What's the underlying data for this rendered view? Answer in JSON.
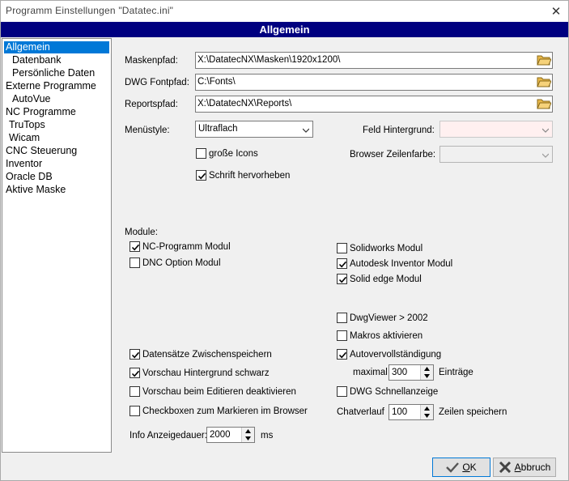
{
  "window": {
    "title": "Programm Einstellungen  \"Datatec.ini\"",
    "close_symbol": "✕"
  },
  "header": {
    "title": "Allgemein"
  },
  "nav": {
    "items": [
      {
        "label": "Allgemein",
        "selected": true
      },
      {
        "label": "Datenbank"
      },
      {
        "label": "Persönliche Daten"
      },
      {
        "label": "Externe Programme"
      },
      {
        "label": "AutoVue"
      },
      {
        "label": "NC Programme"
      },
      {
        "label": "TruTops"
      },
      {
        "label": "Wicam"
      },
      {
        "label": "CNC Steuerung"
      },
      {
        "label": "Inventor"
      },
      {
        "label": "Oracle DB"
      },
      {
        "label": "Aktive Maske"
      }
    ]
  },
  "paths": {
    "masken_label": "Maskenpfad:",
    "masken_value": "X:\\DatatecNX\\Masken\\1920x1200\\",
    "dwg_label": "DWG Fontpfad:",
    "dwg_value": "C:\\Fonts\\",
    "reports_label": "Reportspfad:",
    "reports_value": "X:\\DatatecNX\\Reports\\"
  },
  "style": {
    "menu_label": "Menüstyle:",
    "menu_value": "Ultraflach",
    "feld_label": "Feld Hintergrund:",
    "browser_label": "Browser Zeilenfarbe:",
    "large_icons_label": "große Icons",
    "large_icons_checked": false,
    "highlight_label": "Schrift hervorheben",
    "highlight_checked": true
  },
  "module": {
    "heading": "Module:",
    "nc_label": "NC-Programm Modul",
    "nc_checked": true,
    "dnc_label": "DNC Option Modul",
    "dnc_checked": false,
    "solidworks_label": "Solidworks Modul",
    "solidworks_checked": false,
    "inventor_label": "Autodesk Inventor Modul",
    "inventor_checked": true,
    "solidedge_label": "Solid edge Modul",
    "solidedge_checked": true,
    "dwgviewer_label": "DwgViewer > 2002",
    "dwgviewer_checked": false,
    "makros_label": "Makros aktivieren",
    "makros_checked": false
  },
  "options": {
    "cache_label": "Datensätze Zwischenspeichern",
    "cache_checked": true,
    "preview_black_label": "Vorschau Hintergrund schwarz",
    "preview_black_checked": true,
    "preview_edit_label": "Vorschau beim Editieren deaktivieren",
    "preview_edit_checked": false,
    "browser_cb_label": "Checkboxen zum Markieren im Browser",
    "browser_cb_checked": false,
    "autocomplete_label": "Autovervollständigung",
    "autocomplete_checked": true,
    "maximal_label": "maximal",
    "maximal_value": "300",
    "eintraege_label": "Einträge",
    "dwg_quick_label": "DWG Schnellanzeige",
    "dwg_quick_checked": false,
    "chat_label": "Chatverlauf",
    "chat_value": "100",
    "chat_unit": "Zeilen speichern",
    "info_label": "Info Anzeigedauer:",
    "info_value": "2000",
    "info_unit": "ms"
  },
  "buttons": {
    "ok_label": "OK",
    "ok_u": "O",
    "ok_rest": "K",
    "cancel_label": "Abbruch",
    "cancel_u": "A",
    "cancel_rest": "bbruch"
  }
}
